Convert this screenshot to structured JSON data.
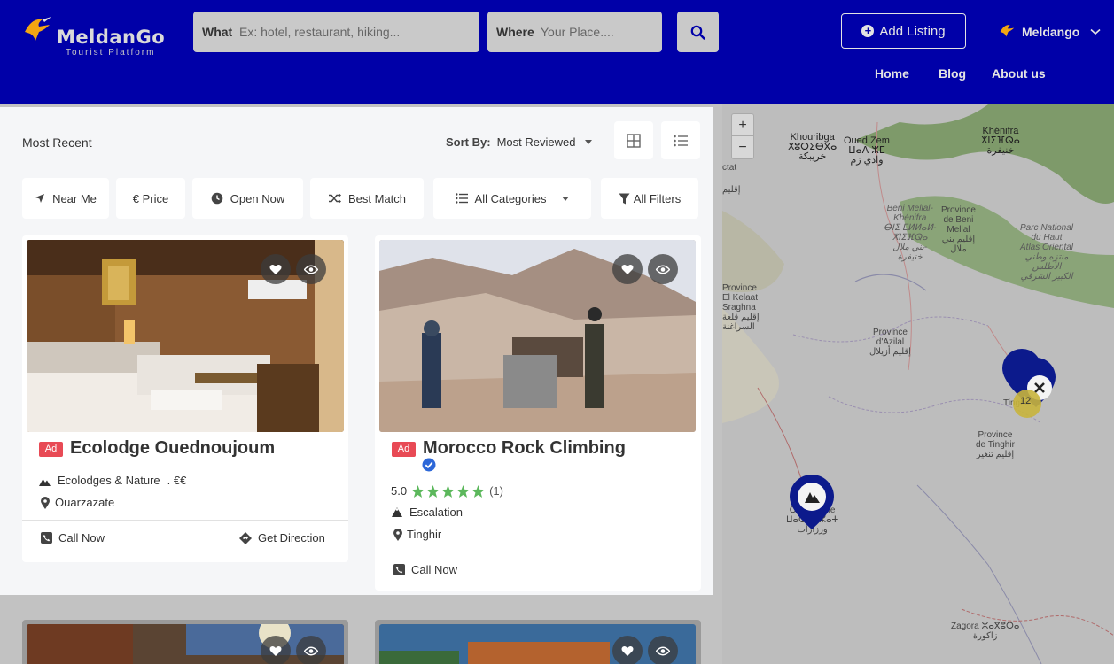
{
  "brand": {
    "name": "MeldanGo",
    "tagline": "Tourist Platform"
  },
  "search": {
    "what_label": "What",
    "what_placeholder": "Ex: hotel, restaurant, hiking...",
    "where_label": "Where",
    "where_placeholder": "Your Place...."
  },
  "header": {
    "add_listing": "Add Listing",
    "user_name": "Meldango",
    "nav": [
      "Home",
      "Blog",
      "About us"
    ]
  },
  "listing": {
    "heading": "Most Recent",
    "sort_label": "Sort By:",
    "sort_value": "Most Reviewed",
    "filters": [
      "Near Me",
      "€ Price",
      "Open Now",
      "Best Match",
      "All Categories",
      "All Filters"
    ]
  },
  "cards": [
    {
      "badge": "Ad",
      "title": "Ecolodge Ouednoujoum",
      "category": "Ecolodges & Nature",
      "price": ". €€",
      "location": "Ouarzazate",
      "call": "Call Now",
      "direction": "Get Direction"
    },
    {
      "badge": "Ad",
      "title": "Morocco Rock Climbing",
      "rating": "5.0",
      "rating_count": "(1)",
      "stars": 5,
      "category": "Escalation",
      "location": "Tinghir",
      "call": "Call Now"
    }
  ],
  "map": {
    "zoom_in": "+",
    "zoom_out": "−",
    "cluster_count": "12",
    "labels": [
      "Khénifra",
      "ⵅⵏⵉⴼⵕⴰ",
      "خنيفرة",
      "Khouribga",
      "ⵅⵓⵔⵉⴱⴳⴰ",
      "خريبكة",
      "Oued Zem",
      "ⵡⴰⴷ ⵣⵎ",
      "وادي زم",
      "Beni Mellal-",
      "Khénifra",
      "ⴱⵏⵉ ⵎⵍⵍⴰⵍ-",
      "ⵅⵏⵉⴼⵕⴰ",
      "بني ملال-",
      "خنيفرة",
      "Province",
      "de Beni",
      "Mellal",
      "إقليم بني",
      "ملال",
      "Parc National",
      "du Haut",
      "Atlas Oriental",
      "منتزه وطني",
      "الأطلس",
      "الكبير الشرقي",
      "Province",
      "El Kelaat",
      "Sraghna",
      "إقليم قلعة",
      "السراغنة",
      "Province",
      "d'Azilal",
      "إقليم أزيلال",
      "Tinghir",
      "Province",
      "de Tinghir",
      "إقليم تنغير",
      "Ouarzazate",
      "ⵡⴰⵔⵣⴰⵣⴰⵜ",
      "ورزازات",
      "Zagora ⵣⴰⴳⵓⵔⴰ",
      "زاكورة",
      "ctat",
      "إقليم"
    ]
  },
  "colors": {
    "header_bg": "#0000a8",
    "ad_badge": "#e84a55",
    "star": "#5cb85c",
    "verified": "#2c67d8",
    "marker": "#0c1a8c"
  }
}
